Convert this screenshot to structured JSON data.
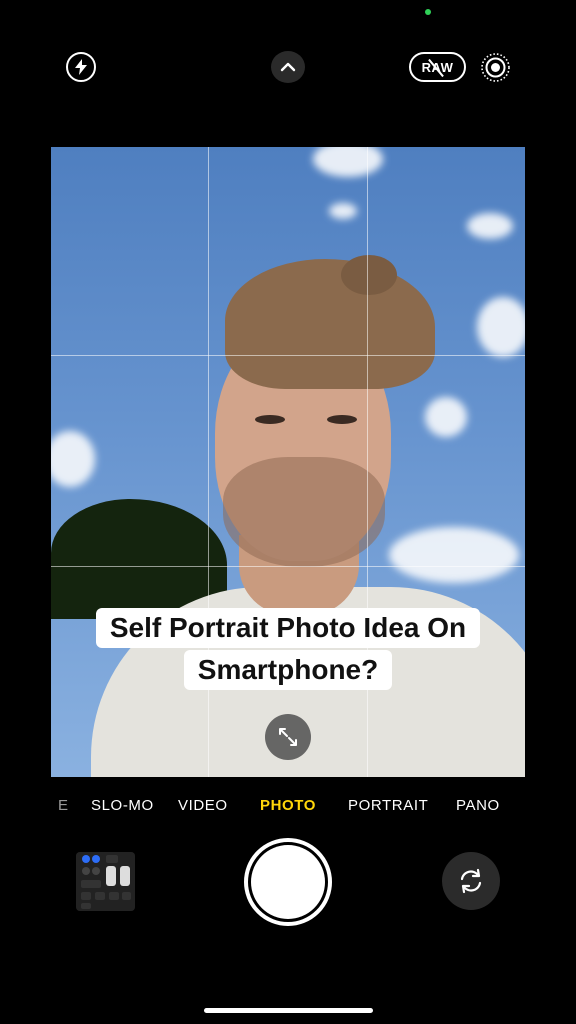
{
  "top_bar": {
    "flash_icon": "lightning-bolt",
    "expand_icon": "chevron-up",
    "raw_label": "RAW",
    "live_icon": "live-photo-rings"
  },
  "viewfinder": {
    "grid": "3x3"
  },
  "caption": {
    "line1": "Self Portrait Photo Idea On",
    "line2": "Smartphone?"
  },
  "zoom_toggle_icon": "expand-arrows",
  "modes": {
    "partial": "E",
    "items": [
      "SLO-MO",
      "VIDEO",
      "PHOTO",
      "PORTRAIT",
      "PANO"
    ],
    "active": "PHOTO",
    "active_color": "#ffd60a"
  },
  "bottom_bar": {
    "thumbnail_icon": "control-center-preview",
    "shutter_icon": "shutter",
    "flip_icon": "camera-flip-arrows"
  }
}
